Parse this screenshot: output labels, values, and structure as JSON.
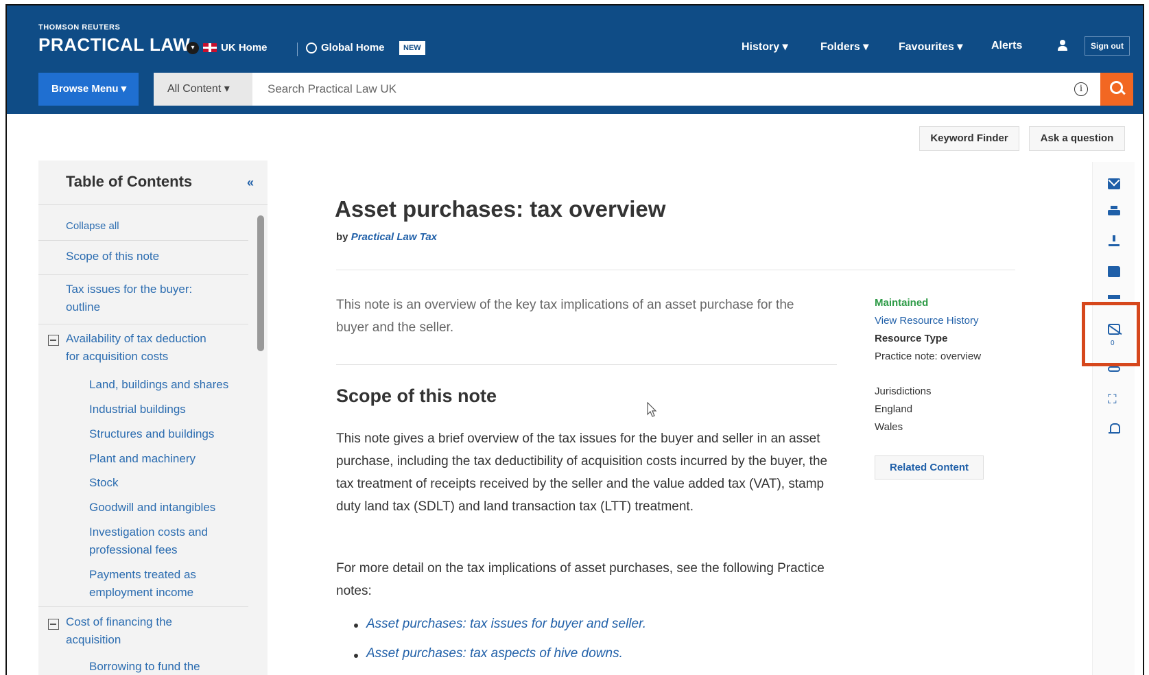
{
  "header": {
    "brand_top": "THOMSON REUTERS",
    "brand_main": "PRACTICAL LAW",
    "uk_home": "UK Home",
    "global_home": "Global Home",
    "new_badge": "NEW",
    "nav": {
      "history": "History ▾",
      "folders": "Folders ▾",
      "favourites": "Favourites ▾",
      "alerts": "Alerts"
    },
    "sign_out": "Sign out"
  },
  "search": {
    "browse_menu": "Browse Menu ▾",
    "scope": "All Content ▾",
    "placeholder": "Search Practical Law UK"
  },
  "utilities": {
    "keyword_finder": "Keyword Finder",
    "ask_question": "Ask a question"
  },
  "toc": {
    "title": "Table of Contents",
    "collapse_all": "Collapse all",
    "items": [
      "Scope of this note",
      "Tax issues for the buyer:",
      "outline",
      "Availability of tax deduction",
      "for acquisition costs",
      "Land, buildings and shares",
      "Industrial buildings",
      "Structures and buildings",
      "Plant and machinery",
      "Stock",
      "Goodwill and intangibles",
      "Investigation costs and",
      "professional fees",
      "Payments treated as",
      "employment income",
      "Cost of financing the",
      "acquisition",
      "Borrowing to fund the"
    ]
  },
  "document": {
    "title": "Asset purchases: tax overview",
    "by": "by",
    "author": "Practical Law Tax",
    "summary": "This note is an overview of the key tax implications of an asset purchase for the buyer and the seller.",
    "section_title": "Scope of this note",
    "para1": "This note gives a brief overview of the tax issues for the buyer and seller in an asset purchase, including the tax deductibility of acquisition costs incurred by the buyer, the tax treatment of receipts received by the seller and the value added tax (VAT), stamp duty land tax (SDLT) and land transaction tax (LTT) treatment.",
    "para2": "For more detail on the tax implications of asset purchases, see the following Practice notes:",
    "bullets": [
      "Asset purchases: tax issues for buyer and seller.",
      "Asset purchases: tax aspects of hive downs."
    ]
  },
  "metadata": {
    "status": "Maintained",
    "history_link": "View Resource History",
    "resource_type_label": "Resource Type",
    "resource_type": "Practice note: overview",
    "jurisdictions_label": "Jurisdictions",
    "jurisdictions": [
      "England",
      "Wales"
    ],
    "related": "Related Content"
  },
  "rail": {
    "annotation_count": "0",
    "icons": [
      "email-icon",
      "print-icon",
      "download-icon",
      "folder-icon",
      "annotations-icon",
      "link-icon",
      "fullscreen-icon",
      "alert-bell-icon"
    ],
    "highlight_color": "#d6471c"
  },
  "colors": {
    "header_bg": "#0f4c86",
    "accent_blue": "#1f6fd1",
    "search_button": "#f26722",
    "link": "#1f5fa8",
    "maintained": "#2e9b47"
  }
}
